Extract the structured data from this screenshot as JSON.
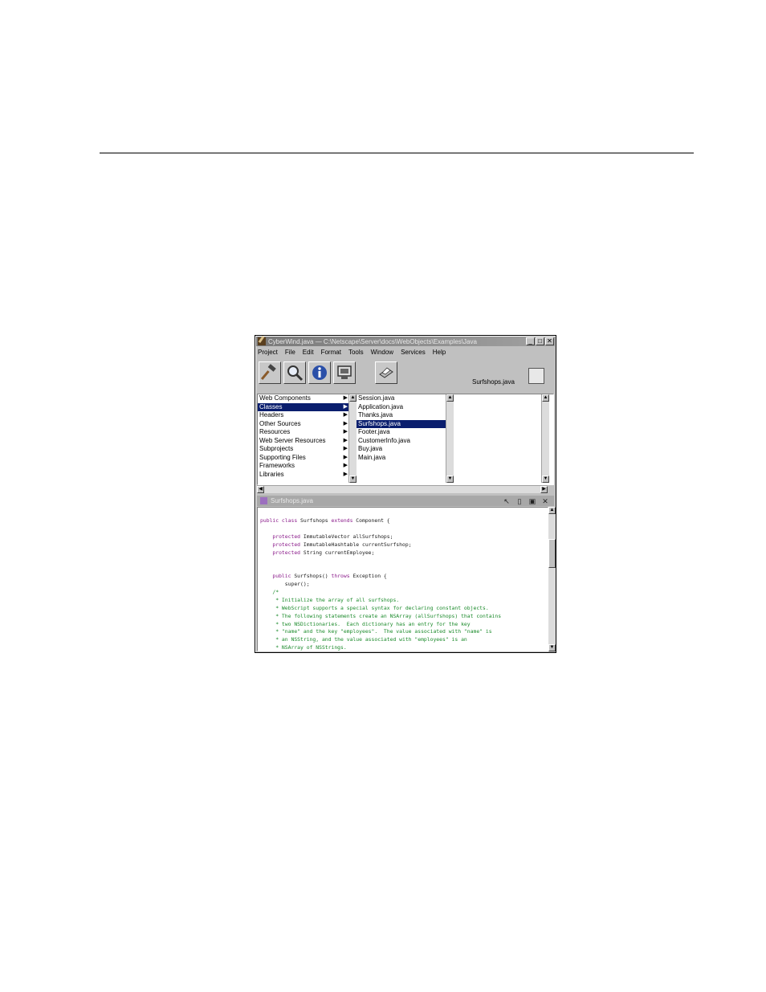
{
  "window": {
    "title": "CyberWind.java  —  C:\\Netscape\\Server\\docs\\WebObjects\\Examples\\Java",
    "controls": [
      "_",
      "□",
      "✕"
    ]
  },
  "menu": [
    "Project",
    "File",
    "Edit",
    "Format",
    "Tools",
    "Window",
    "Services",
    "Help"
  ],
  "toolbar": {
    "icons": [
      "hammer-icon",
      "magnifier-icon",
      "info-icon",
      "monitor-icon",
      "printer-icon"
    ],
    "file_label": "Surfshops.java"
  },
  "browser": {
    "col1": [
      {
        "label": "Web Components",
        "sel": false
      },
      {
        "label": "Classes",
        "sel": true
      },
      {
        "label": "Headers",
        "sel": false
      },
      {
        "label": "Other Sources",
        "sel": false
      },
      {
        "label": "Resources",
        "sel": false
      },
      {
        "label": "Web Server Resources",
        "sel": false
      },
      {
        "label": "Subprojects",
        "sel": false
      },
      {
        "label": "Supporting Files",
        "sel": false
      },
      {
        "label": "Frameworks",
        "sel": false
      },
      {
        "label": "Libraries",
        "sel": false
      }
    ],
    "col2": [
      {
        "label": "Session.java",
        "sel": false
      },
      {
        "label": "Application.java",
        "sel": false
      },
      {
        "label": "Thanks.java",
        "sel": false
      },
      {
        "label": "Surfshops.java",
        "sel": true
      },
      {
        "label": "Footer.java",
        "sel": false
      },
      {
        "label": "CustomerInfo.java",
        "sel": false
      },
      {
        "label": "Buy.java",
        "sel": false
      },
      {
        "label": "Main.java",
        "sel": false
      }
    ]
  },
  "editor": {
    "title": "Surfshops.java",
    "lines": [
      [
        [
          "kw",
          "public class"
        ],
        [
          "t",
          " Surfshops "
        ],
        [
          "kw",
          "extends"
        ],
        [
          "t",
          " Component {"
        ]
      ],
      [
        [
          "t",
          ""
        ]
      ],
      [
        [
          "t",
          "    "
        ],
        [
          "kw",
          "protected"
        ],
        [
          "t",
          " ImmutableVector allSurfshops;"
        ]
      ],
      [
        [
          "t",
          "    "
        ],
        [
          "kw",
          "protected"
        ],
        [
          "t",
          " ImmutableHashtable currentSurfshop;"
        ]
      ],
      [
        [
          "t",
          "    "
        ],
        [
          "kw",
          "protected"
        ],
        [
          "t",
          " String currentEmployee;"
        ]
      ],
      [
        [
          "t",
          ""
        ]
      ],
      [
        [
          "t",
          ""
        ]
      ],
      [
        [
          "t",
          "    "
        ],
        [
          "kw",
          "public"
        ],
        [
          "t",
          " Surfshops() "
        ],
        [
          "kw",
          "throws"
        ],
        [
          "t",
          " Exception {"
        ]
      ],
      [
        [
          "t",
          "        super();"
        ]
      ],
      [
        [
          "cm",
          "    /*"
        ]
      ],
      [
        [
          "cm",
          "     * Initialize the array of all surfshops."
        ]
      ],
      [
        [
          "cm",
          "     * WebScript supports a special syntax for declaring constant objects."
        ]
      ],
      [
        [
          "cm",
          "     * The following statements create an NSArray (allSurfshops) that contains"
        ]
      ],
      [
        [
          "cm",
          "     * two NSDictionaries.  Each dictionary has an entry for the key"
        ]
      ],
      [
        [
          "cm",
          "     * \"name\" and the key \"employees\".  The value associated with \"name\" is"
        ]
      ],
      [
        [
          "cm",
          "     * an NSString, and the value associated with \"employees\" is an"
        ]
      ],
      [
        [
          "cm",
          "     * NSArray of NSStrings."
        ]
      ]
    ]
  }
}
